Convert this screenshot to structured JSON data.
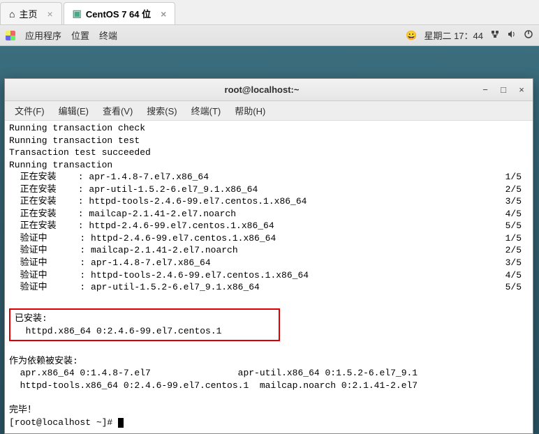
{
  "vmTabs": {
    "home": "主页",
    "active": "CentOS 7 64 位"
  },
  "gnome": {
    "apps": "应用程序",
    "places": "位置",
    "terminal": "终端",
    "clock": "星期二 17：44"
  },
  "terminal": {
    "title": "root@localhost:~",
    "menus": {
      "file": "文件(F)",
      "edit": "编辑(E)",
      "view": "查看(V)",
      "search": "搜索(S)",
      "terminal": "终端(T)",
      "help": "帮助(H)"
    },
    "preLines": [
      "Running transaction check",
      "Running transaction test",
      "Transaction test succeeded",
      "Running transaction"
    ],
    "installRows": [
      {
        "label": "  正在安装    : apr-1.4.8-7.el7.x86_64",
        "count": "1/5"
      },
      {
        "label": "  正在安装    : apr-util-1.5.2-6.el7_9.1.x86_64",
        "count": "2/5"
      },
      {
        "label": "  正在安装    : httpd-tools-2.4.6-99.el7.centos.1.x86_64",
        "count": "3/5"
      },
      {
        "label": "  正在安装    : mailcap-2.1.41-2.el7.noarch",
        "count": "4/5"
      },
      {
        "label": "  正在安装    : httpd-2.4.6-99.el7.centos.1.x86_64",
        "count": "5/5"
      },
      {
        "label": "  验证中      : httpd-2.4.6-99.el7.centos.1.x86_64",
        "count": "1/5"
      },
      {
        "label": "  验证中      : mailcap-2.1.41-2.el7.noarch",
        "count": "2/5"
      },
      {
        "label": "  验证中      : apr-1.4.8-7.el7.x86_64",
        "count": "3/5"
      },
      {
        "label": "  验证中      : httpd-tools-2.4.6-99.el7.centos.1.x86_64",
        "count": "4/5"
      },
      {
        "label": "  验证中      : apr-util-1.5.2-6.el7_9.1.x86_64",
        "count": "5/5"
      }
    ],
    "installedHeader": "已安装:",
    "installedPkg": "  httpd.x86_64 0:2.4.6-99.el7.centos.1",
    "depsHeader": "作为依赖被安装:",
    "depsLine1": "  apr.x86_64 0:1.4.8-7.el7                apr-util.x86_64 0:1.5.2-6.el7_9.1",
    "depsLine2": "  httpd-tools.x86_64 0:2.4.6-99.el7.centos.1  mailcap.noarch 0:2.1.41-2.el7",
    "done": "完毕！",
    "prompt": "[root@localhost ~]# "
  }
}
